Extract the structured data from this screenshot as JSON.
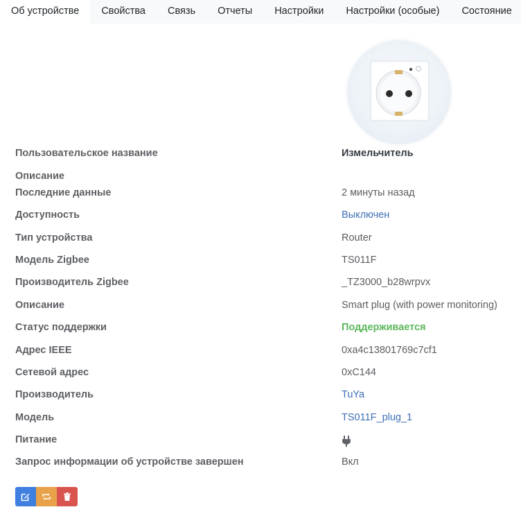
{
  "tabs": [
    {
      "label": "Об устройстве",
      "active": true
    },
    {
      "label": "Свойства"
    },
    {
      "label": "Связь"
    },
    {
      "label": "Отчеты"
    },
    {
      "label": "Настройки"
    },
    {
      "label": "Настройки (особые)"
    },
    {
      "label": "Состояние"
    }
  ],
  "device": {
    "image_icon": "smart-plug-image",
    "properties": [
      {
        "label": "Пользовательское название",
        "value": "Измельчитель",
        "style": "strong"
      },
      {
        "label": "Описание",
        "value": ""
      },
      {
        "label": "Последние данные",
        "value": "2 минуты назад"
      },
      {
        "label": "Доступность",
        "value": "Выключен",
        "style": "link"
      },
      {
        "label": "Тип устройства",
        "value": "Router"
      },
      {
        "label": "Модель Zigbee",
        "value": "TS011F"
      },
      {
        "label": "Производитель Zigbee",
        "value": "_TZ3000_b28wrpvx"
      },
      {
        "label": "Описание",
        "value": "Smart plug (with power monitoring)"
      },
      {
        "label": "Статус поддержки",
        "value": "Поддерживается",
        "style": "success"
      },
      {
        "label": "Адрес IEEE",
        "value": "0xa4c13801769c7cf1"
      },
      {
        "label": "Сетевой адрес",
        "value": "0xC144"
      },
      {
        "label": "Производитель",
        "value": "TuYa",
        "style": "link"
      },
      {
        "label": "Модель",
        "value": "TS011F_plug_1",
        "style": "link"
      },
      {
        "label": "Питание",
        "value": "",
        "icon": "plug-icon"
      },
      {
        "label": "Запрос информации об устройстве завершен",
        "value": "Вкл"
      }
    ]
  },
  "actions": [
    {
      "name": "edit-button",
      "icon": "edit-icon",
      "color": "#3e7fe0"
    },
    {
      "name": "interview-button",
      "icon": "refresh-icon",
      "color": "#e8a24a"
    },
    {
      "name": "remove-button",
      "icon": "trash-icon",
      "color": "#d9534f"
    }
  ],
  "colors": {
    "link": "#3d6fb6",
    "success": "#5cb85c",
    "label": "#5c5f63"
  }
}
